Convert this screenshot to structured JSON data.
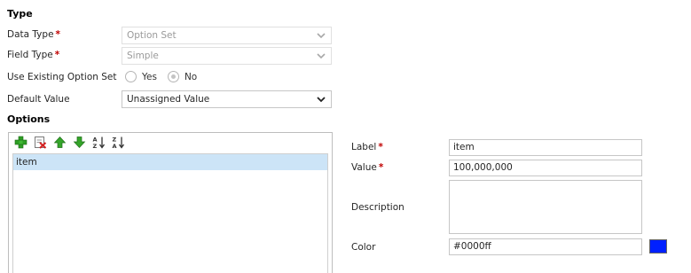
{
  "type_section": {
    "heading": "Type",
    "data_type": {
      "label": "Data Type",
      "value": "Option Set"
    },
    "field_type": {
      "label": "Field Type",
      "value": "Simple"
    },
    "use_existing": {
      "label": "Use Existing Option Set",
      "options": [
        "Yes",
        "No"
      ],
      "selected": "No"
    },
    "default_value": {
      "label": "Default Value",
      "value": "Unassigned Value"
    }
  },
  "options_section": {
    "heading": "Options",
    "toolbar_icons": [
      "add-icon",
      "delete-icon",
      "move-up-icon",
      "move-down-icon",
      "sort-ascending-icon",
      "sort-descending-icon"
    ],
    "sort_asc_text": "A Z",
    "sort_desc_text": "Z A",
    "items": [
      "item"
    ]
  },
  "detail": {
    "label": {
      "label": "Label",
      "value": "item"
    },
    "value": {
      "label": "Value",
      "value": "100,000,000"
    },
    "description": {
      "label": "Description",
      "value": ""
    },
    "color": {
      "label": "Color",
      "value": "#0000ff",
      "swatch": "#0020ff"
    }
  },
  "required_marker": "*"
}
